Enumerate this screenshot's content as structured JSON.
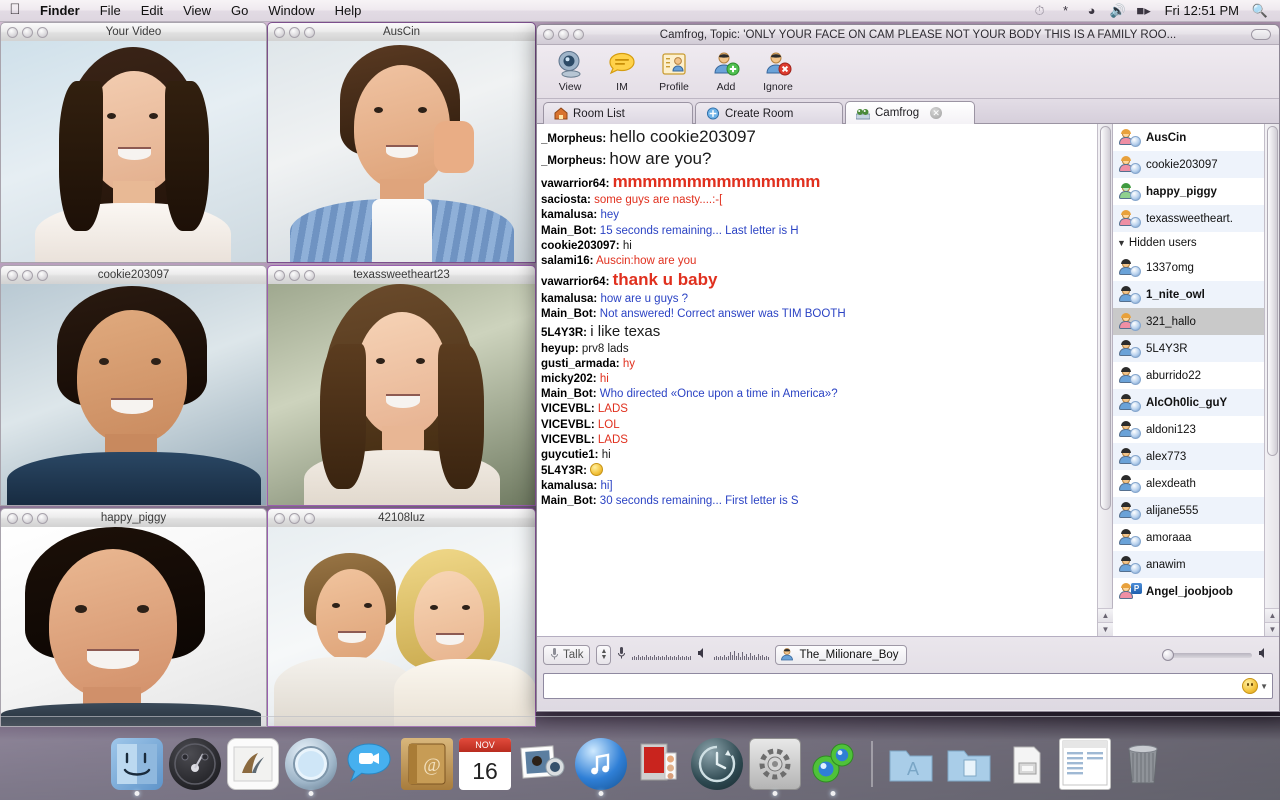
{
  "menubar": {
    "apple": "apple-logo",
    "items": [
      {
        "label": "Finder",
        "bold": true
      },
      {
        "label": "File",
        "bold": false
      },
      {
        "label": "Edit",
        "bold": false
      },
      {
        "label": "View",
        "bold": false
      },
      {
        "label": "Go",
        "bold": false
      },
      {
        "label": "Window",
        "bold": false
      },
      {
        "label": "Help",
        "bold": false
      }
    ],
    "status_icons": [
      "timemachine-icon",
      "bluetooth-icon",
      "wifi-icon",
      "volume-icon",
      "battery-icon"
    ],
    "clock": "Fri 12:51 PM",
    "search_icon": "spotlight-search-icon"
  },
  "video_windows": [
    {
      "title": "Your Video"
    },
    {
      "title": "AusCin"
    },
    {
      "title": "cookie203097"
    },
    {
      "title": "texassweetheart23"
    },
    {
      "title": "happy_piggy"
    },
    {
      "title": "42108luz"
    }
  ],
  "camfrog": {
    "window_title": "Camfrog, Topic: 'ONLY YOUR FACE ON  CAM  PLEASE   NOT YOUR  BODY   THIS IS A  FAMILY ROO...",
    "toolbar": [
      {
        "label": "View",
        "icon": "webcam-icon"
      },
      {
        "label": "IM",
        "icon": "speech-bubble-icon"
      },
      {
        "label": "Profile",
        "icon": "profile-card-icon"
      },
      {
        "label": "Add",
        "icon": "add-user-icon"
      },
      {
        "label": "Ignore",
        "icon": "ignore-user-icon"
      }
    ],
    "tabs": [
      {
        "label": "Room List",
        "icon": "house-icon",
        "active": false,
        "closable": false
      },
      {
        "label": "Create Room",
        "icon": "plus-circle-icon",
        "active": false,
        "closable": false
      },
      {
        "label": "Camfrog",
        "icon": "camfrog-icon",
        "active": true,
        "closable": true
      }
    ],
    "chat": [
      {
        "nick": "_Morpheus:",
        "text": "hello cookie203097",
        "style": "big1",
        "color": "black"
      },
      {
        "nick": "_Morpheus:",
        "text": "how are you?",
        "style": "big1",
        "color": "black"
      },
      {
        "nick": "vawarrior64:",
        "text": "mmmmmmmmmmmmmm",
        "style": "huge-red",
        "color": "red"
      },
      {
        "nick": "saciosta:",
        "text": "some guys are nasty....:-[",
        "style": "",
        "color": "red"
      },
      {
        "nick": "kamalusa:",
        "text": "hey",
        "style": "",
        "color": "blue"
      },
      {
        "nick": "Main_Bot:",
        "text": "15 seconds remaining... Last letter is H",
        "style": "",
        "color": "blue"
      },
      {
        "nick": "cookie203097:",
        "text": "hi",
        "style": "",
        "color": "black"
      },
      {
        "nick": "salami16:",
        "text": "Auscin:how are you",
        "style": "",
        "color": "red"
      },
      {
        "nick": "vawarrior64:",
        "text": "thank u baby",
        "style": "big2",
        "color": "red"
      },
      {
        "nick": "kamalusa:",
        "text": "how are u guys ?",
        "style": "",
        "color": "blue"
      },
      {
        "nick": "Main_Bot:",
        "text": "Not answered! Correct answer was TIM BOOTH",
        "style": "",
        "color": "blue"
      },
      {
        "nick": "5L4Y3R:",
        "text": "i like texas",
        "style": "big3",
        "color": "black"
      },
      {
        "nick": "heyup:",
        "text": "prv8 lads",
        "style": "",
        "color": "black"
      },
      {
        "nick": "gusti_armada:",
        "text": "hy",
        "style": "",
        "color": "red"
      },
      {
        "nick": "micky202:",
        "text": "hi",
        "style": "",
        "color": "red"
      },
      {
        "nick": "Main_Bot:",
        "text": "Who directed «Once upon a time in America»?",
        "style": "",
        "color": "blue"
      },
      {
        "nick": "VICEVBL:",
        "text": "LADS",
        "style": "",
        "color": "red"
      },
      {
        "nick": "VICEVBL:",
        "text": "LOL",
        "style": "",
        "color": "red"
      },
      {
        "nick": "VICEVBL:",
        "text": "LADS",
        "style": "",
        "color": "red"
      },
      {
        "nick": "guycutie1:",
        "text": "hi",
        "style": "",
        "color": "black"
      },
      {
        "nick": "5L4Y3R:",
        "text": "",
        "style": "emoji",
        "color": "black"
      },
      {
        "nick": "kamalusa:",
        "text": "hi]",
        "style": "",
        "color": "blue"
      },
      {
        "nick": "Main_Bot:",
        "text": "30 seconds remaining... First letter is S",
        "style": "",
        "color": "blue"
      }
    ],
    "userlist": {
      "visible_users": [
        {
          "name": "AusCin",
          "bold": true,
          "avatar": "female-cam-avatar"
        },
        {
          "name": "cookie203097",
          "bold": false,
          "avatar": "female-cam-avatar"
        },
        {
          "name": "happy_piggy",
          "bold": true,
          "avatar": "green-cam-avatar"
        },
        {
          "name": "texassweetheart.",
          "bold": false,
          "avatar": "female-cam-avatar"
        }
      ],
      "hidden_group_label": "Hidden users",
      "hidden_users": [
        {
          "name": "1337omg",
          "bold": false,
          "avatar": "male-cam-avatar"
        },
        {
          "name": "1_nite_owl",
          "bold": true,
          "avatar": "male-cam-avatar"
        },
        {
          "name": "321_hallo",
          "bold": false,
          "avatar": "female-cam-avatar",
          "selected": true
        },
        {
          "name": "5L4Y3R",
          "bold": false,
          "avatar": "male-cam-avatar"
        },
        {
          "name": "aburrido22",
          "bold": false,
          "avatar": "male-cam-avatar"
        },
        {
          "name": "AlcOh0lic_guY",
          "bold": true,
          "avatar": "male-cam-avatar"
        },
        {
          "name": "aldoni123",
          "bold": false,
          "avatar": "male-cam-avatar"
        },
        {
          "name": "alex773",
          "bold": false,
          "avatar": "male-cam-avatar"
        },
        {
          "name": "alexdeath",
          "bold": false,
          "avatar": "male-cam-avatar"
        },
        {
          "name": "alijane555",
          "bold": false,
          "avatar": "male-cam-avatar"
        },
        {
          "name": "amoraaa",
          "bold": false,
          "avatar": "male-cam-avatar"
        },
        {
          "name": "anawim",
          "bold": false,
          "avatar": "male-cam-avatar"
        },
        {
          "name": "Angel_joobjoob",
          "bold": true,
          "avatar": "female-pro-avatar"
        }
      ]
    },
    "bottom": {
      "talk_label": "Talk",
      "mic_icon": "microphone-icon",
      "speaker_icon": "speaker-icon",
      "nickname": "The_Milionare_Boy",
      "nick_icon": "user-icon",
      "volume_icon": "volume-icon",
      "message_value": "",
      "message_placeholder": "",
      "smiley_icon": "smiley-icon"
    }
  },
  "dock": {
    "items": [
      {
        "name": "finder",
        "icon": "finder-icon",
        "running": true
      },
      {
        "name": "dashboard",
        "icon": "dashboard-icon",
        "running": false
      },
      {
        "name": "mail",
        "icon": "mail-icon",
        "running": false
      },
      {
        "name": "safari",
        "icon": "safari-icon",
        "running": true
      },
      {
        "name": "ichat",
        "icon": "ichat-icon",
        "running": false
      },
      {
        "name": "address-book",
        "icon": "address-book-icon",
        "running": false
      },
      {
        "name": "ical",
        "icon": "ical-icon",
        "running": false,
        "month": "NOV",
        "day": "16"
      },
      {
        "name": "iphoto",
        "icon": "iphoto-icon",
        "running": false
      },
      {
        "name": "itunes",
        "icon": "itunes-icon",
        "running": true
      },
      {
        "name": "photo-booth",
        "icon": "photo-booth-icon",
        "running": false
      },
      {
        "name": "time-machine",
        "icon": "time-machine-icon",
        "running": false
      },
      {
        "name": "system-preferences",
        "icon": "system-preferences-icon",
        "running": true
      },
      {
        "name": "camfrog",
        "icon": "camfrog-dock-icon",
        "running": true
      },
      {
        "name": "applications-folder",
        "icon": "applications-folder-icon",
        "running": false
      },
      {
        "name": "documents-folder",
        "icon": "documents-folder-icon",
        "running": false
      },
      {
        "name": "downloads-stack",
        "icon": "downloads-stack-icon",
        "running": false
      },
      {
        "name": "document-window",
        "icon": "document-window-icon",
        "running": false
      },
      {
        "name": "trash",
        "icon": "trash-icon",
        "running": false
      }
    ]
  }
}
